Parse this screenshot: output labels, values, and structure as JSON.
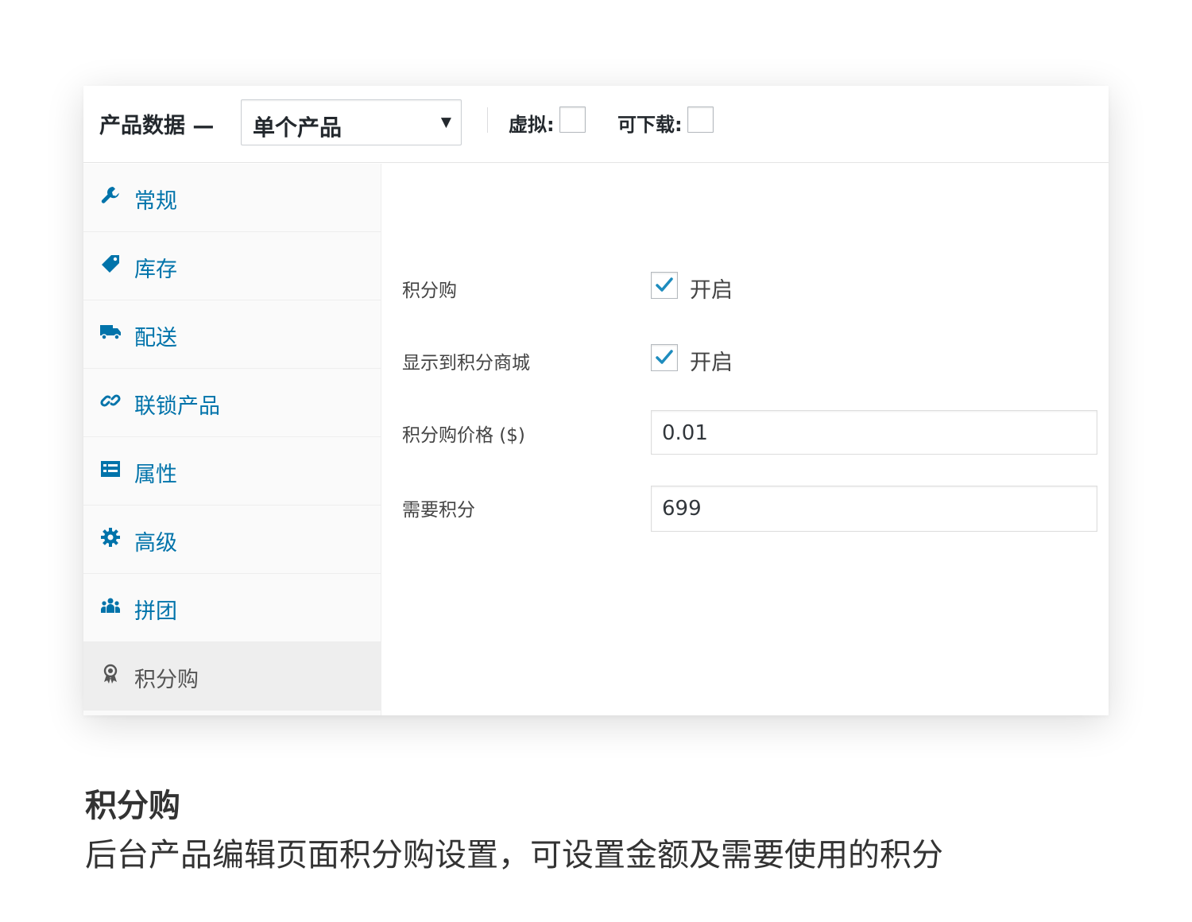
{
  "header": {
    "title": "产品数据 —",
    "product_type": {
      "selected": "单个产品",
      "arrow": "▼"
    },
    "virtual_label": "虚拟:",
    "virtual_checked": false,
    "downloadable_label": "可下载:",
    "downloadable_checked": false
  },
  "sidebar": {
    "items": [
      {
        "label": "常规",
        "icon": "wrench-icon",
        "active": false
      },
      {
        "label": "库存",
        "icon": "tag-icon",
        "active": false
      },
      {
        "label": "配送",
        "icon": "truck-icon",
        "active": false
      },
      {
        "label": "联锁产品",
        "icon": "link-icon",
        "active": false
      },
      {
        "label": "属性",
        "icon": "list-icon",
        "active": false
      },
      {
        "label": "高级",
        "icon": "gear-icon",
        "active": false
      },
      {
        "label": "拼团",
        "icon": "groups-icon",
        "active": false
      },
      {
        "label": "积分购",
        "icon": "award-icon",
        "active": true
      }
    ]
  },
  "panel": {
    "points_purchase": {
      "label": "积分购",
      "checked": true,
      "option": "开启"
    },
    "show_in_points_mall": {
      "label": "显示到积分商城",
      "checked": true,
      "option": "开启"
    },
    "points_price": {
      "label": "积分购价格 ($)",
      "value": "0.01"
    },
    "required_points": {
      "label": "需要积分",
      "value": "699"
    }
  },
  "caption": {
    "title": "积分购",
    "description": "后台产品编辑页面积分购设置，可设置金额及需要使用的积分"
  },
  "colors": {
    "link": "#0073aa",
    "active_tab_bg": "#eeeeee",
    "sidebar_bg": "#fafafa",
    "check": "#1e8cbe"
  }
}
